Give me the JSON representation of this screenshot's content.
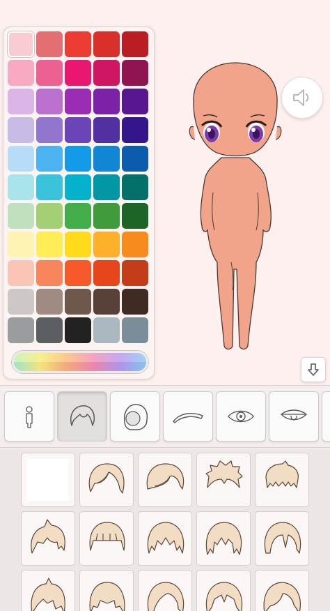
{
  "palette": {
    "selected_index": 0,
    "swatches": [
      "#f9cbd3",
      "#e36f72",
      "#ee3b33",
      "#d9302c",
      "#bb1d22",
      "#f6a9c1",
      "#ec6192",
      "#e9176f",
      "#cf1662",
      "#8f1450",
      "#dcb5e7",
      "#bb6fce",
      "#9a2cb6",
      "#7b22a7",
      "#5a168f",
      "#c8bbe6",
      "#9276cd",
      "#6b45b8",
      "#5130a2",
      "#33168a",
      "#b7dcf8",
      "#4db3f0",
      "#139be9",
      "#1186d4",
      "#0b5cac",
      "#a9e4ec",
      "#3bc3dc",
      "#06b2cb",
      "#0397a5",
      "#05706a",
      "#bfe1bd",
      "#a3d075",
      "#41ae4a",
      "#3f9b3b",
      "#1c6527",
      "#fff3b3",
      "#ffec56",
      "#ffdb1c",
      "#fdb12a",
      "#f78b1e",
      "#fbc5b5",
      "#f8865d",
      "#f8592a",
      "#e7461c",
      "#c33d1a",
      "#cdc8c5",
      "#9f8b82",
      "#70574e",
      "#574037",
      "#3f2b24",
      "#9b9c9e",
      "#5c5f61",
      "#222222",
      "#aab7bf",
      "#7a8d98"
    ],
    "rainbow_label": "rainbow-color-slider"
  },
  "buttons": {
    "sound_icon": "speaker-icon",
    "download_icon": "download-arrow-icon"
  },
  "tabs": [
    {
      "name": "body",
      "icon": "body-icon"
    },
    {
      "name": "hair-front",
      "icon": "hair-front-icon"
    },
    {
      "name": "hair-back",
      "icon": "hair-back-icon"
    },
    {
      "name": "eyebrows",
      "icon": "eyebrow-icon"
    },
    {
      "name": "eyes",
      "icon": "eye-icon"
    },
    {
      "name": "mouth",
      "icon": "mouth-icon"
    }
  ],
  "active_tab": "hair-front",
  "items_count_visible": 15
}
